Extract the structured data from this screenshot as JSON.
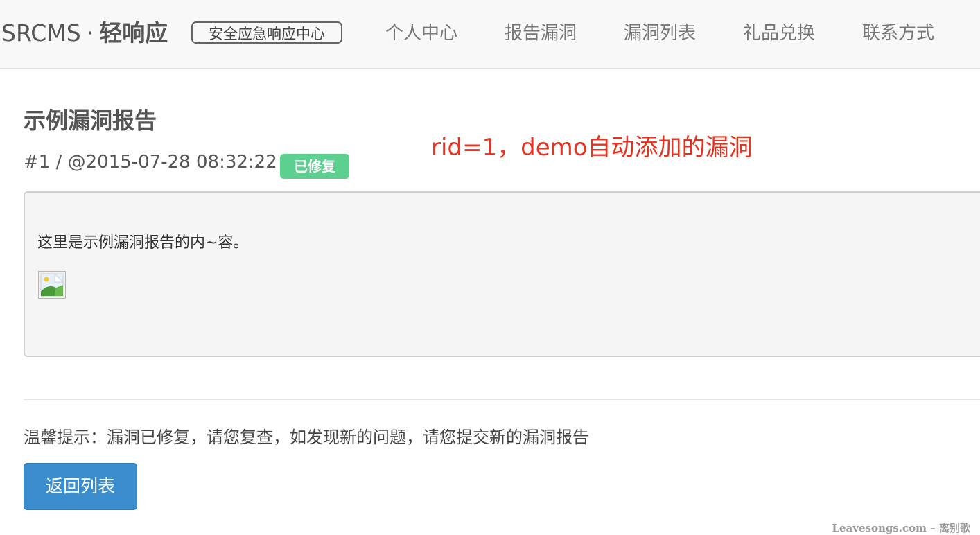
{
  "navbar": {
    "brand": "SRCMS",
    "brand_separator": "·",
    "brand_cn": "轻响应",
    "brand_badge": "安全应急响应中心",
    "links": [
      "个人中心",
      "报告漏洞",
      "漏洞列表",
      "礼品兑换",
      "联系方式"
    ]
  },
  "report": {
    "title": "示例漏洞报告",
    "meta": "#1 / @2015-07-28 08:32:22 /",
    "status": "已修复",
    "content": "这里是示例漏洞报告的内~容。",
    "image_icon": "broken-image-icon"
  },
  "annotation": "rid=1，demo自动添加的漏洞",
  "tip": "温馨提示：漏洞已修复，请您复查，如发现新的问题，请您提交新的漏洞报告",
  "back_button": "返回列表",
  "watermark": "Leavesongs.com – 离别歌",
  "colors": {
    "status_badge": "#5cd08f",
    "primary_button": "#3c8dcd",
    "annotation": "#e8321e",
    "navbar_bg": "#f8f8f8"
  }
}
